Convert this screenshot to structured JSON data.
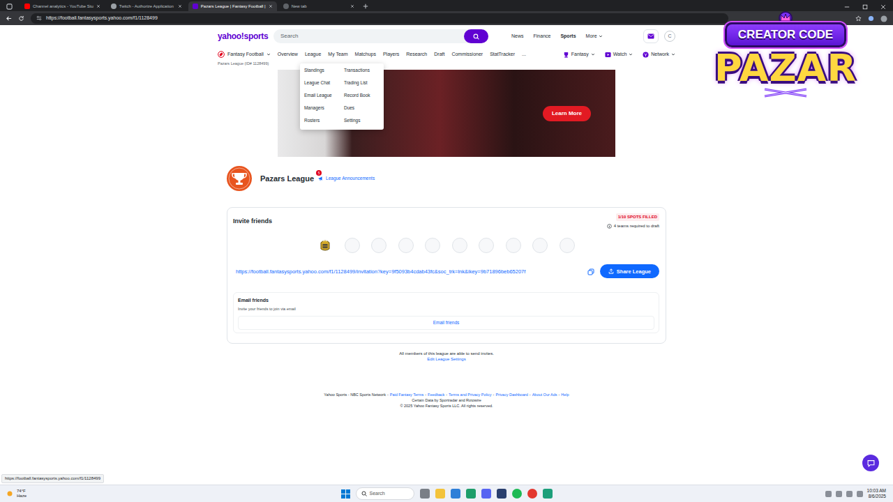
{
  "browser": {
    "tabs": [
      {
        "label": "Channel analytics - YouTube Stu",
        "selected": false
      },
      {
        "label": "Twitch - Authorize Application",
        "selected": false
      },
      {
        "label": "Pazars League | Fantasy Football |",
        "selected": true
      },
      {
        "label": "New tab",
        "selected": false
      }
    ],
    "url": "https://football.fantasysports.yahoo.com/f1/1128499",
    "status_url": "https://football.fantasysports.yahoo.com/f1/1128499"
  },
  "header": {
    "logo": "yahoo!sports",
    "search": {
      "placeholder": "Search"
    },
    "links": [
      {
        "label": "News",
        "selected": false
      },
      {
        "label": "Finance",
        "selected": false
      },
      {
        "label": "Sports",
        "selected": true
      },
      {
        "label": "More",
        "selected": false
      }
    ],
    "avatar": "C"
  },
  "subnav": {
    "app": "Fantasy Football",
    "items": [
      {
        "label": "Overview"
      },
      {
        "label": "League",
        "menu": {
          "open": true,
          "columns": [
            [
              "Standings",
              "League Chat",
              "Email League",
              "Managers",
              "Rosters"
            ],
            [
              "Transactions",
              "Trading List",
              "Record Book",
              "Dues",
              "Settings"
            ]
          ]
        }
      },
      {
        "label": "My Team"
      },
      {
        "label": "Matchups"
      },
      {
        "label": "Players"
      },
      {
        "label": "Research"
      },
      {
        "label": "Draft"
      },
      {
        "label": "Commissioner"
      },
      {
        "label": "StatTracker"
      },
      {
        "label": "..."
      }
    ],
    "right": [
      "Fantasy",
      "Watch",
      "Network"
    ],
    "league_id": "Pazars League (ID# 1128499)"
  },
  "ad": {
    "button": "Learn More"
  },
  "league": {
    "name": "Pazars League",
    "badge": "5",
    "announcements": "League Announcements"
  },
  "invite": {
    "title": "Invite friends",
    "spots": "1/10 SPOTS FILLED",
    "required": "4 teams required to draft",
    "slots": [
      {
        "filled": true
      },
      {
        "filled": false
      },
      {
        "filled": false
      },
      {
        "filled": false
      },
      {
        "filled": false
      },
      {
        "filled": false
      },
      {
        "filled": false
      },
      {
        "filled": false
      },
      {
        "filled": false
      },
      {
        "filled": false
      }
    ],
    "link": "https://football.fantasysports.yahoo.com/f1/1128499/invitation?key=9f5093b4cdab43fc&soc_trk=lnk&ikey=9b71896beb65207f",
    "share": "Share League",
    "email": {
      "title": "Email friends",
      "subtitle": "Invite your friends to join via email",
      "button": "Email friends"
    }
  },
  "members_note": "All members of this league are able to send invites.",
  "edit_settings": "Edit League Settings",
  "footer": {
    "links": [
      "Yahoo Sports - NBC Sports Network",
      "Paid Fantasy Terms",
      "Feedback",
      "Terms and Privacy Policy",
      "Privacy Dashboard",
      "About Our Ads",
      "Help"
    ],
    "separator": "-",
    "data_line": "Certain Data by Sportradar and Rotowire",
    "copyright": "© 2025 Yahoo Fantasy Sports LLC. All rights reserved."
  },
  "overlay": {
    "line1": "CREATOR CODE",
    "line2": "PAZAR"
  },
  "taskbar": {
    "temp": "74°F",
    "weather": "Haze",
    "search": "Search",
    "time": "10:03 AM",
    "date": "8/6/2025"
  }
}
